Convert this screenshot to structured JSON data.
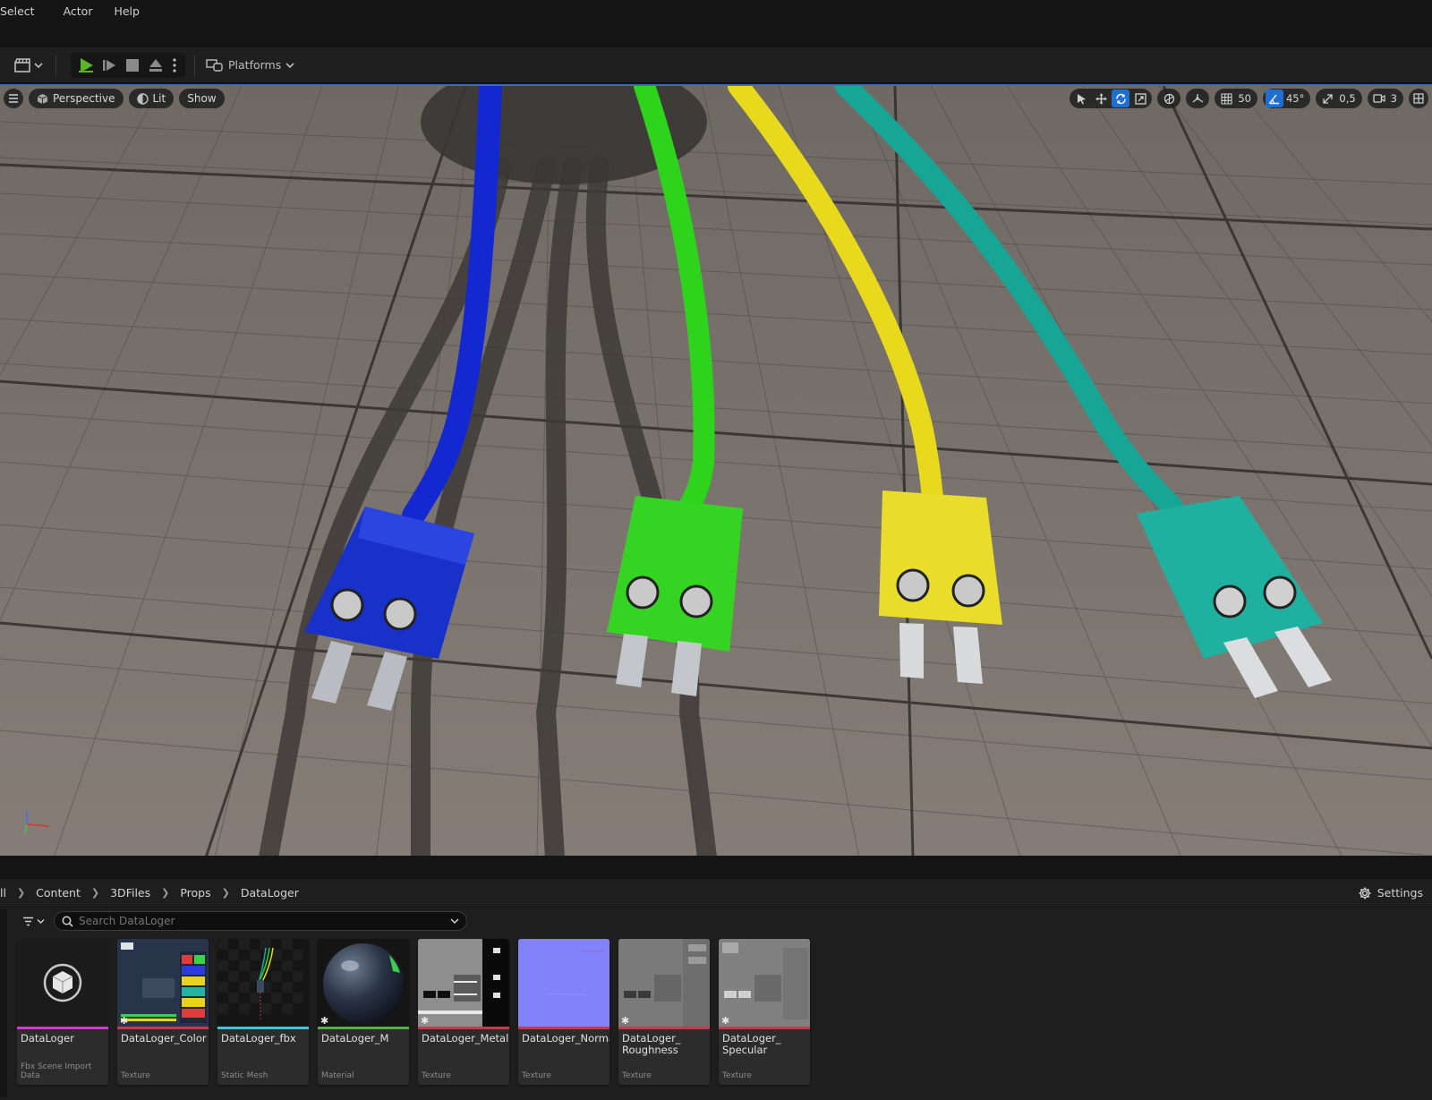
{
  "menu": [
    "Select",
    "Actor",
    "Help"
  ],
  "toolbar": {
    "platforms_label": "Platforms"
  },
  "viewport": {
    "perspective_label": "Perspective",
    "lit_label": "Lit",
    "show_label": "Show",
    "grid_snap": "50",
    "angle_snap": "45°",
    "scale_snap": "0,5",
    "camera_speed": "3"
  },
  "content_browser": {
    "breadcrumb": [
      "ll",
      "Content",
      "3DFiles",
      "Props",
      "DataLoger"
    ],
    "settings_label": "Settings",
    "search_placeholder": "Search DataLoger",
    "assets": [
      {
        "name": "DataLoger",
        "kind": "Fbx Scene Import Data",
        "bar_color": "#d13bd1"
      },
      {
        "name": "DataLoger_Color",
        "kind": "Texture",
        "bar_color": "#c9394b"
      },
      {
        "name": "DataLoger_fbx",
        "kind": "Static Mesh",
        "bar_color": "#3fc6d8"
      },
      {
        "name": "DataLoger_M",
        "kind": "Material",
        "bar_color": "#52b342"
      },
      {
        "name": "DataLoger_Metalic",
        "kind": "Texture",
        "bar_color": "#c9394b"
      },
      {
        "name": "DataLoger_Normal",
        "kind": "Texture",
        "bar_color": "#c9394b"
      },
      {
        "name": "DataLoger_\nRoughness",
        "kind": "Texture",
        "bar_color": "#c9394b"
      },
      {
        "name": "DataLoger_\nSpecular",
        "kind": "Texture",
        "bar_color": "#c9394b"
      }
    ]
  },
  "colors": {
    "cable_blue": "#1428d2",
    "cable_green": "#2ed41c",
    "cable_yellow": "#e8d91c",
    "cable_teal": "#17a596",
    "accent": "#1f6fd1"
  }
}
